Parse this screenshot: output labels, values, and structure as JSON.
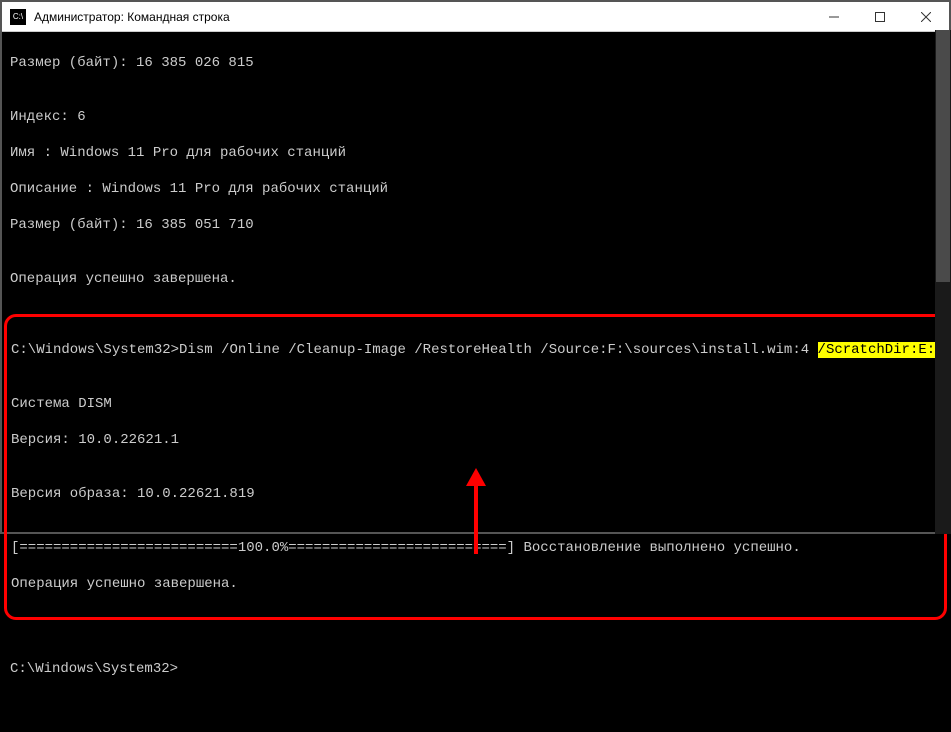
{
  "titlebar": {
    "icon_text": "C:\\",
    "title": "Администратор: Командная строка"
  },
  "terminal": {
    "line_size1": "Размер (байт): 16 385 026 815",
    "blank": "",
    "line_index": "Индекс: 6",
    "line_name": "Имя : Windows 11 Pro для рабочих станций",
    "line_desc": "Описание : Windows 11 Pro для рабочих станций",
    "line_size2": "Размер (байт): 16 385 051 710",
    "line_done1": "Операция успешно завершена.",
    "box": {
      "prompt": "C:\\Windows\\System32>",
      "cmd_main": "Dism /Online /Cleanup-Image /RestoreHealth /Source:F:\\sources\\install.wim:4 ",
      "cmd_hl": "/ScratchDir:E:\\",
      "system": "Cистема DISM",
      "version": "Версия: 10.0.22621.1",
      "image_version": "Версия образа: 10.0.22621.819",
      "progress": "[==========================100.0%==========================] Восстановление выполнено успешно.",
      "done": "Операция успешно завершена."
    },
    "prompt_after": "C:\\Windows\\System32>"
  }
}
